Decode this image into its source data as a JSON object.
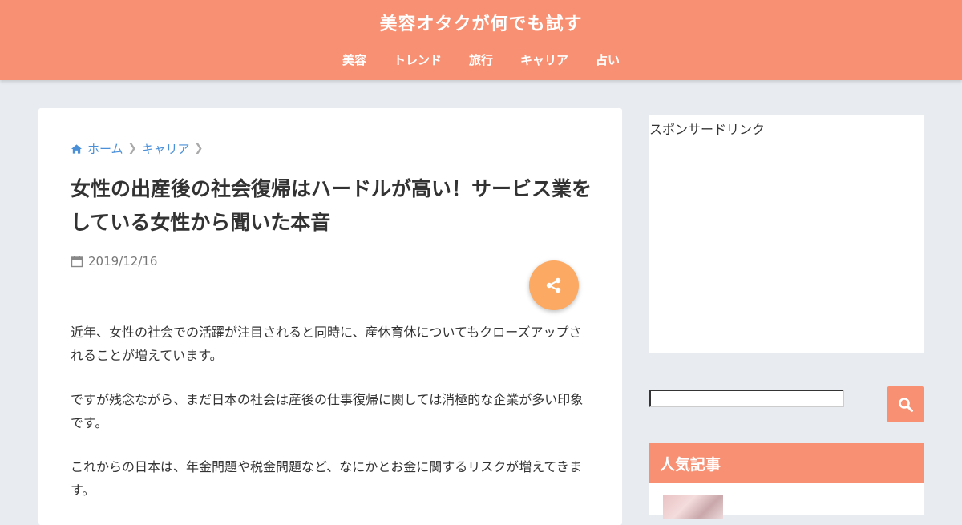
{
  "header": {
    "site_title": "美容オタクが何でも試す",
    "nav": [
      "美容",
      "トレンド",
      "旅行",
      "キャリア",
      "占い"
    ]
  },
  "breadcrumb": {
    "home_label": "ホーム",
    "category_label": "キャリア"
  },
  "article": {
    "title": "女性の出産後の社会復帰はハードルが高い！サービス業をしている女性から聞いた本音",
    "date": "2019/12/16",
    "paragraphs": [
      "近年、女性の社会での活躍が注目されると同時に、産休育休についてもクローズアップされることが増えています。",
      "ですが残念ながら、まだ日本の社会は産後の仕事復帰に関しては消極的な企業が多い印象です。",
      "これからの日本は、年金問題や税金問題など、なにかとお金に関するリスクが増えてきます。"
    ]
  },
  "sidebar": {
    "ad_label": "スポンサードリンク",
    "search_placeholder": "",
    "popular_title": "人気記事"
  },
  "colors": {
    "brand": "#f89174",
    "share": "#fca964",
    "link": "#4a90d9"
  },
  "icons": [
    "home-icon",
    "calendar-icon",
    "share-icon",
    "search-icon"
  ]
}
